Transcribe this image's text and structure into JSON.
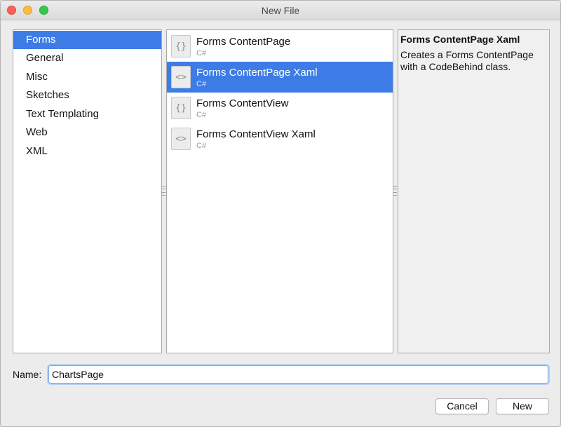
{
  "window": {
    "title": "New File"
  },
  "categories": [
    {
      "label": "Forms",
      "selected": true
    },
    {
      "label": "General",
      "selected": false
    },
    {
      "label": "Misc",
      "selected": false
    },
    {
      "label": "Sketches",
      "selected": false
    },
    {
      "label": "Text Templating",
      "selected": false
    },
    {
      "label": "Web",
      "selected": false
    },
    {
      "label": "XML",
      "selected": false
    }
  ],
  "templates": [
    {
      "name": "Forms ContentPage",
      "language": "C#",
      "icon": "braces-file-icon",
      "selected": false
    },
    {
      "name": "Forms ContentPage Xaml",
      "language": "C#",
      "icon": "xml-file-icon",
      "selected": true
    },
    {
      "name": "Forms ContentView",
      "language": "C#",
      "icon": "braces-file-icon",
      "selected": false
    },
    {
      "name": "Forms ContentView Xaml",
      "language": "C#",
      "icon": "xml-file-icon",
      "selected": false
    }
  ],
  "description": {
    "title": "Forms ContentPage Xaml",
    "text": "Creates a Forms ContentPage with a CodeBehind class."
  },
  "name_field": {
    "label": "Name:",
    "value": "ChartsPage"
  },
  "buttons": {
    "cancel": "Cancel",
    "new": "New"
  },
  "colors": {
    "selection": "#3d7ce6",
    "focus_ring": "#b7d2f5"
  }
}
